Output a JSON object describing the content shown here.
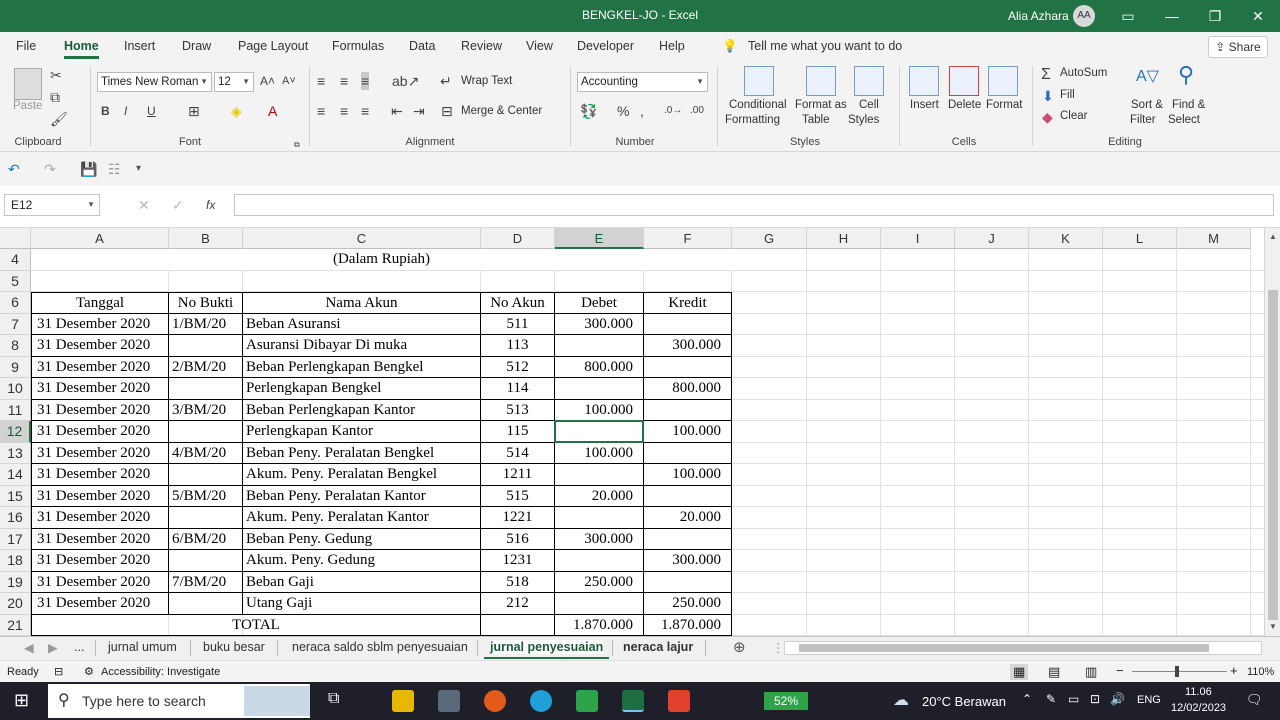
{
  "window": {
    "title": "BENGKEL-JO  -  Excel",
    "user_name": "Alia Azhara",
    "user_initials": "AA"
  },
  "ribbon_tabs": [
    "File",
    "Home",
    "Insert",
    "Draw",
    "Page Layout",
    "Formulas",
    "Data",
    "Review",
    "View",
    "Developer",
    "Help"
  ],
  "tell_me": "Tell me what you want to do",
  "share_label": "Share",
  "ribbon": {
    "clipboard": {
      "paste": "Paste",
      "label": "Clipboard"
    },
    "font": {
      "name": "Times New Roman",
      "size": "12",
      "label": "Font",
      "bold": "B",
      "italic": "I",
      "underline": "U"
    },
    "alignment": {
      "wrap": "Wrap Text",
      "merge": "Merge & Center",
      "label": "Alignment"
    },
    "number": {
      "format": "Accounting",
      "label": "Number",
      "percent": "%"
    },
    "styles": {
      "cond": "Conditional",
      "cond2": "Formatting",
      "fat": "Format as",
      "fat2": "Table",
      "cell": "Cell",
      "cell2": "Styles",
      "label": "Styles"
    },
    "cells": {
      "insert": "Insert",
      "delete": "Delete",
      "format": "Format",
      "label": "Cells"
    },
    "editing": {
      "autosum": "AutoSum",
      "fill": "Fill",
      "clear": "Clear",
      "sort": "Sort &",
      "sort2": "Filter",
      "find": "Find &",
      "find2": "Select",
      "label": "Editing"
    }
  },
  "formula_bar": {
    "name_box": "E12",
    "fx": "fx",
    "formula": ""
  },
  "columns": [
    "A",
    "B",
    "C",
    "D",
    "E",
    "F",
    "G",
    "H",
    "I",
    "J",
    "K",
    "L",
    "M"
  ],
  "sheet": {
    "subtitle": "(Dalam Rupiah)",
    "headers": [
      "Tanggal",
      "No Bukti",
      "Nama Akun",
      "No Akun",
      "Debet",
      "Kredit"
    ],
    "rows": [
      {
        "r": "7",
        "tanggal": "31 Desember 2020",
        "bukti": "1/BM/20",
        "akun": "Beban Asuransi",
        "no": "511",
        "debet": "300.000",
        "kredit": ""
      },
      {
        "r": "8",
        "tanggal": "31 Desember 2020",
        "bukti": "",
        "akun": "Asuransi Dibayar Di muka",
        "no": "113",
        "debet": "",
        "kredit": "300.000"
      },
      {
        "r": "9",
        "tanggal": "31 Desember 2020",
        "bukti": "2/BM/20",
        "akun": "Beban Perlengkapan Bengkel",
        "no": "512",
        "debet": "800.000",
        "kredit": ""
      },
      {
        "r": "10",
        "tanggal": "31 Desember 2020",
        "bukti": "",
        "akun": "Perlengkapan Bengkel",
        "no": "114",
        "debet": "",
        "kredit": "800.000"
      },
      {
        "r": "11",
        "tanggal": "31 Desember 2020",
        "bukti": "3/BM/20",
        "akun": "Beban Perlengkapan Kantor",
        "no": "513",
        "debet": "100.000",
        "kredit": ""
      },
      {
        "r": "12",
        "tanggal": "31 Desember 2020",
        "bukti": "",
        "akun": "Perlengkapan Kantor",
        "no": "115",
        "debet": "",
        "kredit": "100.000"
      },
      {
        "r": "13",
        "tanggal": "31 Desember 2020",
        "bukti": "4/BM/20",
        "akun": "Beban Peny. Peralatan Bengkel",
        "no": "514",
        "debet": "100.000",
        "kredit": ""
      },
      {
        "r": "14",
        "tanggal": "31 Desember 2020",
        "bukti": "",
        "akun": "Akum. Peny. Peralatan Bengkel",
        "no": "1211",
        "debet": "",
        "kredit": "100.000"
      },
      {
        "r": "15",
        "tanggal": "31 Desember 2020",
        "bukti": "5/BM/20",
        "akun": "Beban Peny. Peralatan Kantor",
        "no": "515",
        "debet": "20.000",
        "kredit": ""
      },
      {
        "r": "16",
        "tanggal": "31 Desember 2020",
        "bukti": "",
        "akun": "Akum. Peny. Peralatan Kantor",
        "no": "1221",
        "debet": "",
        "kredit": "20.000"
      },
      {
        "r": "17",
        "tanggal": "31 Desember 2020",
        "bukti": "6/BM/20",
        "akun": "Beban Peny. Gedung",
        "no": "516",
        "debet": "300.000",
        "kredit": ""
      },
      {
        "r": "18",
        "tanggal": "31 Desember 2020",
        "bukti": "",
        "akun": "Akum. Peny. Gedung",
        "no": "1231",
        "debet": "",
        "kredit": "300.000"
      },
      {
        "r": "19",
        "tanggal": "31 Desember 2020",
        "bukti": "7/BM/20",
        "akun": "Beban Gaji",
        "no": "518",
        "debet": "250.000",
        "kredit": ""
      },
      {
        "r": "20",
        "tanggal": "31 Desember 2020",
        "bukti": "",
        "akun": "Utang Gaji",
        "no": "212",
        "debet": "",
        "kredit": "250.000"
      }
    ],
    "total_label": "TOTAL",
    "total_debet": "1.870.000",
    "total_kredit": "1.870.000"
  },
  "sheet_tabs": [
    "...",
    "jurnal umum",
    "buku besar",
    "neraca saldo sblm penyesuaian",
    "jurnal penyesuaian",
    "neraca lajur"
  ],
  "active_sheet": "jurnal penyesuaian",
  "status": {
    "ready": "Ready",
    "accessibility": "Accessibility: Investigate",
    "zoom": "110%"
  },
  "taskbar": {
    "search_placeholder": "Type here to search",
    "battery": "52%",
    "weather": "20°C  Berawan",
    "lang": "ENG",
    "time": "11.06",
    "date": "12/02/2023"
  }
}
